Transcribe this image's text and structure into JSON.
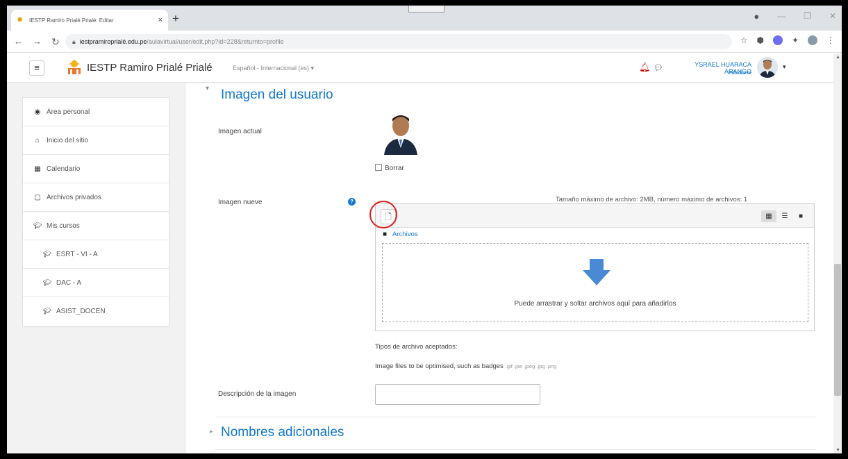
{
  "browser": {
    "tab_title": "IESTP Ramiro Prialé Prialé: Editar",
    "tab_close": "×",
    "new_tab": "+",
    "url_host": "iestpramiroprialé.edu.pe",
    "url_path": "/aulavirtual/user/edit.php?id=228&returnto=profile"
  },
  "navbar": {
    "menu_icon": "≡",
    "site_name": "IESTP Ramiro Prialé Prialé",
    "language": "Español - Internacional (es) ▾",
    "user_name": "YSRAEL HUARACA ARANGO",
    "user_role": "Estudiante",
    "user_caret": "▾"
  },
  "sidebar": {
    "items": [
      {
        "label": "Área personal",
        "icon": "dashboard-icon"
      },
      {
        "label": "Inicio del sitio",
        "icon": "home-icon"
      },
      {
        "label": "Calendario",
        "icon": "calendar-icon"
      },
      {
        "label": "Archivos privados",
        "icon": "file-icon"
      },
      {
        "label": "Mis cursos",
        "icon": "graduation-cap-icon"
      },
      {
        "label": "ESRT - VI - A",
        "icon": "graduation-cap-icon"
      },
      {
        "label": "DAC - A",
        "icon": "graduation-cap-icon"
      },
      {
        "label": "ASIST_DOCEN",
        "icon": "graduation-cap-icon"
      }
    ]
  },
  "form": {
    "section_title": "Imagen del usuario",
    "current_image_label": "Imagen actual",
    "delete_label": "Borrar",
    "new_image_label": "Imagen nueve",
    "max_size": "Tamaño máximo de archivo: 2MB, número máximo de archivos: 1",
    "files_label": "Archivos",
    "drop_text": "Puede arrastrar y soltar archivos aquí para añadirlos",
    "accepted_types_label": "Tipos de archivo aceptados:",
    "accepted_types_desc": "Image files to be optimised, such as badges",
    "accepted_types_ext": ".gif .jpe .jpeg .jpg .png",
    "image_description_label": "Descripción de la imagen",
    "image_description_value": "",
    "section2_title": "Nombres adicionales"
  },
  "colors": {
    "link": "#1177d1",
    "highlight": "#e01c1c",
    "drop_arrow": "#4a8ad4"
  }
}
